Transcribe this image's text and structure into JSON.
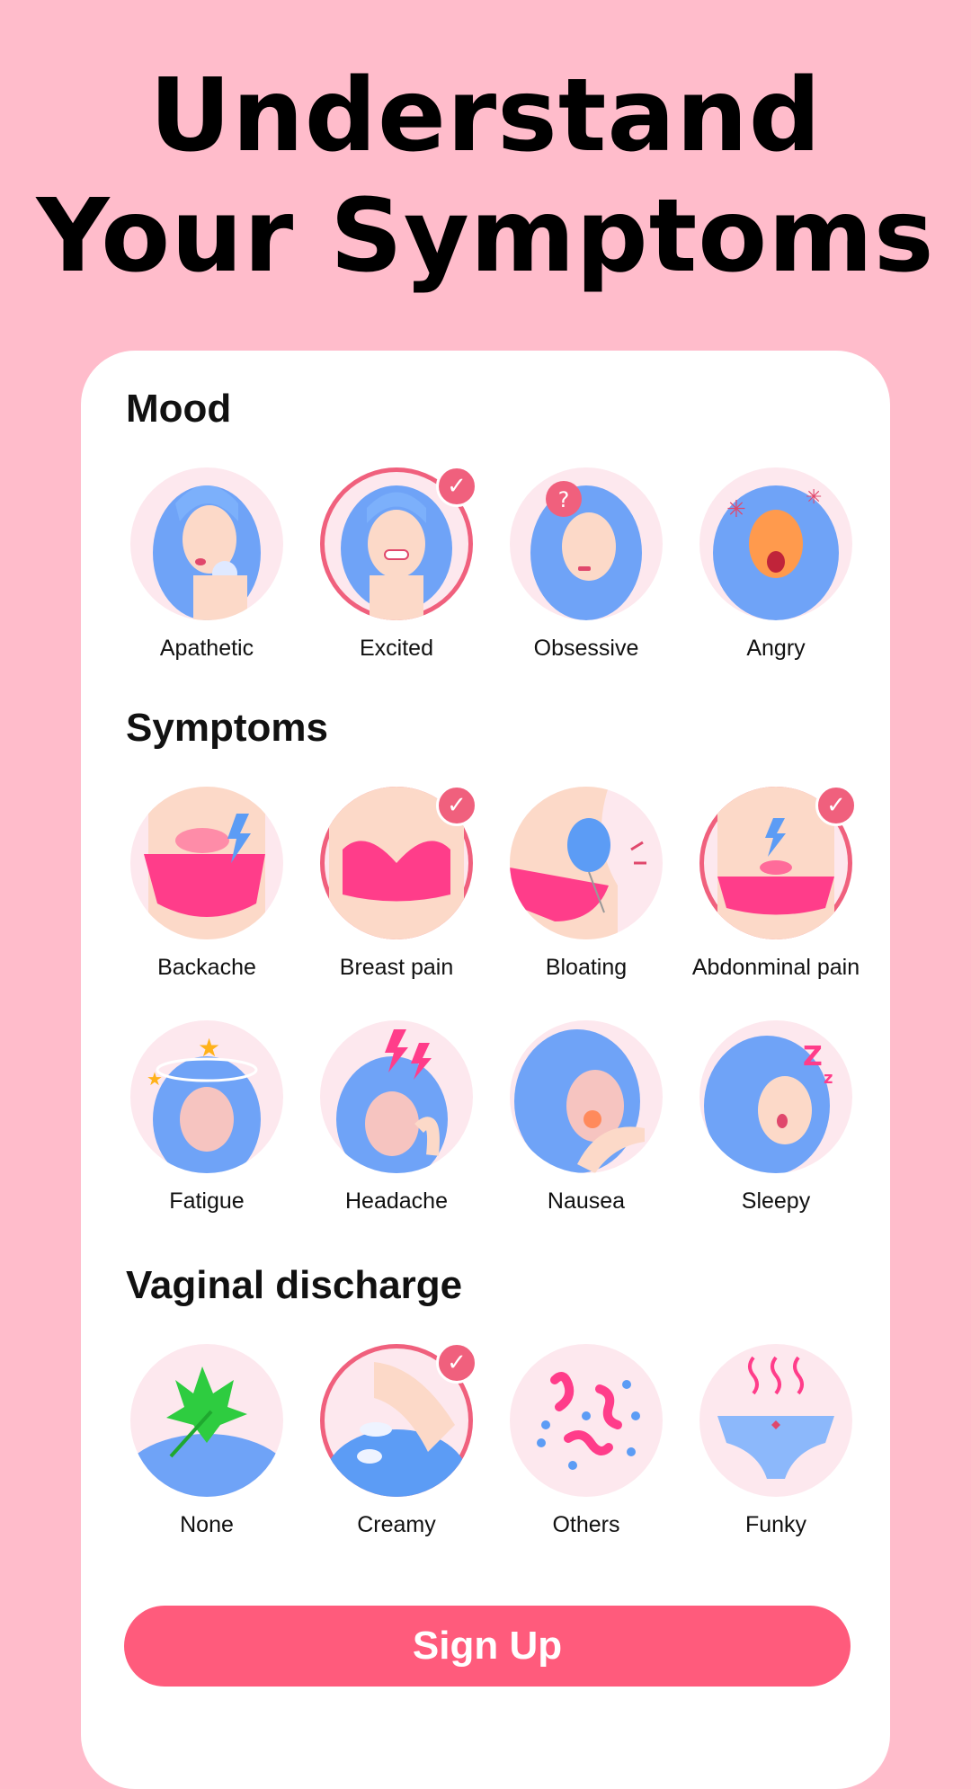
{
  "headline": {
    "line1": "Understand",
    "line2": "Your Symptoms"
  },
  "sections": {
    "mood": {
      "title": "Mood",
      "items": [
        {
          "label": "Apathetic",
          "icon": "apathetic-icon",
          "selected": false
        },
        {
          "label": "Excited",
          "icon": "excited-icon",
          "selected": true
        },
        {
          "label": "Obsessive",
          "icon": "obsessive-icon",
          "selected": false
        },
        {
          "label": "Angry",
          "icon": "angry-icon",
          "selected": false
        }
      ]
    },
    "symptoms": {
      "title": "Symptoms",
      "items": [
        {
          "label": "Backache",
          "icon": "backache-icon",
          "selected": false
        },
        {
          "label": "Breast pain",
          "icon": "breast-pain-icon",
          "selected": true
        },
        {
          "label": "Bloating",
          "icon": "bloating-icon",
          "selected": false
        },
        {
          "label": "Abdonminal pain",
          "icon": "abdominal-pain-icon",
          "selected": true
        },
        {
          "label": "Fatigue",
          "icon": "fatigue-icon",
          "selected": false
        },
        {
          "label": "Headache",
          "icon": "headache-icon",
          "selected": false
        },
        {
          "label": "Nausea",
          "icon": "nausea-icon",
          "selected": false
        },
        {
          "label": "Sleepy",
          "icon": "sleepy-icon",
          "selected": false
        }
      ]
    },
    "discharge": {
      "title": "Vaginal discharge",
      "items": [
        {
          "label": "None",
          "icon": "leaf-icon",
          "selected": false
        },
        {
          "label": "Creamy",
          "icon": "creamy-icon",
          "selected": true
        },
        {
          "label": "Others",
          "icon": "others-icon",
          "selected": false
        },
        {
          "label": "Funky",
          "icon": "funky-icon",
          "selected": false
        }
      ]
    }
  },
  "signup_label": "Sign Up",
  "colors": {
    "background": "#ffbccb",
    "accent": "#ff5b7c",
    "check": "#f0607d"
  }
}
